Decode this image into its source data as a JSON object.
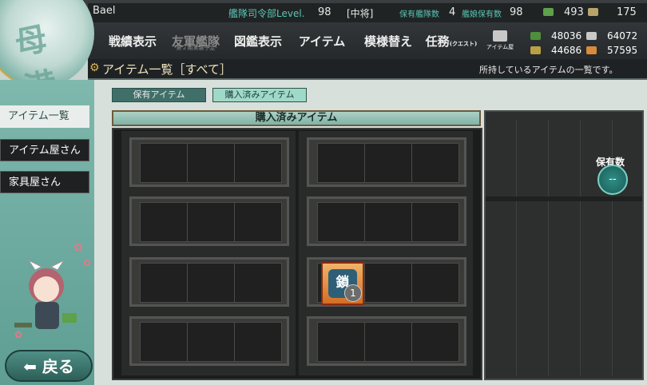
{
  "header": {
    "player_name": "Bael",
    "hq_level_label": "艦隊司令部Level.",
    "hq_level": "98",
    "rank": "[中将]",
    "fleets_label": "保有艦隊数",
    "fleets": "4",
    "ships_label": "艦娘保有数",
    "ships": "98",
    "bucket_count": "493",
    "devmat_count": "175"
  },
  "menu": {
    "items": [
      {
        "label": "戦績表示"
      },
      {
        "label": "友軍艦隊",
        "sub": "-第２期実装予定-"
      },
      {
        "label": "図鑑表示"
      },
      {
        "label": "アイテム"
      },
      {
        "label": "模様替え"
      },
      {
        "label": "任務",
        "small": "(クエスト)"
      }
    ],
    "shop_label": "アイテム屋"
  },
  "resources": {
    "fuel": "48036",
    "steel": "64072",
    "ammo": "44686",
    "bauxite": "57595"
  },
  "subheader": {
    "title": "アイテム一覧［すべて］",
    "description": "所持しているアイテムの一覧です。"
  },
  "sidebar": {
    "items": [
      {
        "label": "アイテム一覧"
      },
      {
        "label": "アイテム屋さん"
      },
      {
        "label": "家具屋さん"
      }
    ],
    "back_label": "戻る"
  },
  "tabs": [
    {
      "label": "保有アイテム"
    },
    {
      "label": "購入済みアイテム"
    }
  ],
  "shelf_title": "購入済みアイテム",
  "item": {
    "glyph": "鎖",
    "count": "1"
  },
  "owned": {
    "label": "保有数",
    "value": "--"
  },
  "colors": {
    "teal_accent": "#58c7b6",
    "gold_frame": "#caa644",
    "item_orange": "#d46d24"
  }
}
